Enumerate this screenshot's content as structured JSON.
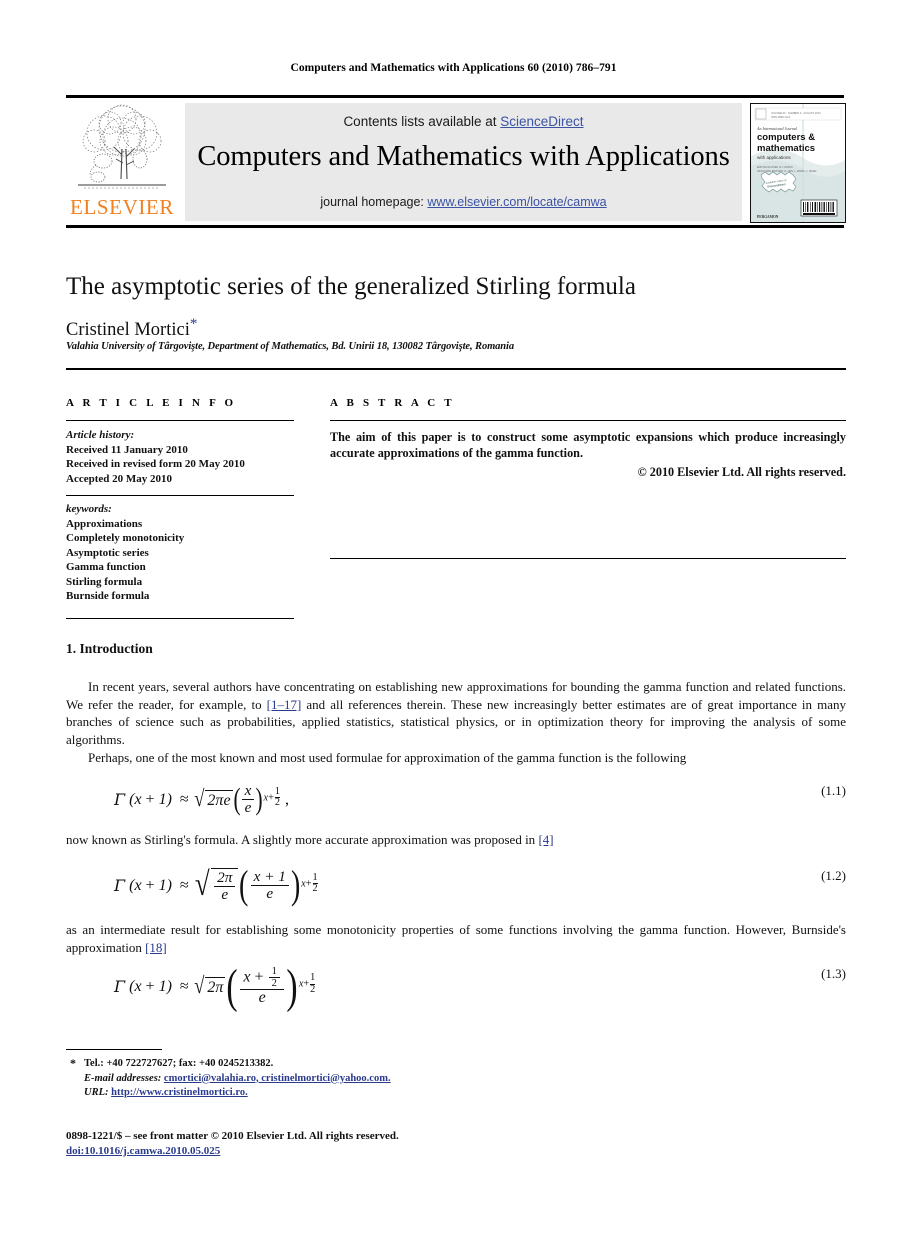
{
  "running_head": "Computers and Mathematics with Applications 60 (2010) 786–791",
  "masthead": {
    "contents_prefix": "Contents lists available at ",
    "sciencedirect": "ScienceDirect",
    "journal_name": "Computers and Mathematics with Applications",
    "homepage_prefix": "journal homepage: ",
    "homepage_url": "www.elsevier.com/locate/camwa",
    "publisher_word": "ELSEVIER",
    "publisher_color": "#F08020",
    "link_color": "#3a53a4",
    "cover": {
      "issn_label": "ISSN 0898-1221",
      "tagline": "An International Journal",
      "line1": "computers &",
      "line2": "mathematics",
      "line3": "with applications",
      "editors": "EDITOR-IN-CHIEF: E.Y. RODIN",
      "editors2": "ASSOCIATE EDITORS: G. HAN, L. WANG, Y. WANG",
      "seal": "available online at ScienceDirect",
      "footer": "PERGAMON"
    }
  },
  "article": {
    "title": "The asymptotic series of the generalized Stirling formula",
    "author": "Cristinel Mortici",
    "author_mark": "*",
    "affiliation": "Valahia University of Târgovişte, Department of Mathematics, Bd. Unirii 18, 130082 Târgovişte, Romania"
  },
  "info": {
    "heading": "A R T I C L E    I N F O",
    "history_label": "Article history:",
    "history": [
      "Received 11 January 2010",
      "Received in revised form 20 May 2010",
      "Accepted 20 May 2010"
    ],
    "keywords_label": "keywords:",
    "keywords": [
      "Approximations",
      "Completely monotonicity",
      "Asymptotic series",
      "Gamma function",
      "Stirling formula",
      "Burnside formula"
    ]
  },
  "abstract": {
    "heading": "A B S T R A C T",
    "text": "The aim of this paper is to construct some asymptotic expansions which produce increasingly accurate approximations of the gamma function.",
    "copyright": "© 2010 Elsevier Ltd. All rights reserved."
  },
  "body": {
    "section_heading": "1. Introduction",
    "p1_a": "In recent years, several authors have concentrating on establishing new approximations for bounding the gamma function and related functions. We refer the reader, for example, to ",
    "p1_ref": "[1–17]",
    "p1_b": " and all references therein. These new increasingly better estimates are of great importance in many branches of science such as probabilities, applied statistics, statistical physics, or in optimization theory for improving the analysis of some algorithms.",
    "p2": "Perhaps, one of the most known and most used formulae for approximation of the gamma function is the following",
    "p3_a": "now known as Stirling's formula. A slightly more accurate approximation was proposed in ",
    "p3_ref": "[4]",
    "p4_a": "as an intermediate result for establishing some monotonicity properties of some functions involving the gamma function. However, Burnside's approximation ",
    "p4_ref": "[18]"
  },
  "equations": {
    "eq1_num": "(1.1)",
    "eq1_latex": "\\Gamma(x+1) \\approx \\sqrt{2\\pi e}\\left(\\frac{x}{e}\\right)^{x+\\frac{1}{2}},",
    "eq2_num": "(1.2)",
    "eq2_latex": "\\Gamma(x+1) \\approx \\sqrt{\\frac{2\\pi}{e}}\\left(\\frac{x+1}{e}\\right)^{x+\\frac{1}{2}}",
    "eq3_num": "(1.3)",
    "eq3_latex": "\\Gamma(x+1) \\approx \\sqrt{2\\pi}\\left(\\frac{x+\\frac{1}{2}}{e}\\right)^{x+\\frac{1}{2}}",
    "gamma": "Γ",
    "approx": "≈",
    "pi": "π",
    "radical": "√",
    "var_x": "x",
    "var_e": "e",
    "one": "1",
    "two": "2",
    "two_pi_e": "2πe",
    "two_pi": "2π",
    "x_plus_one": "x + 1",
    "exponent": "x+",
    "comma": ","
  },
  "footnote": {
    "star": "*",
    "tel": "Tel.: +40 722727627; fax: +40 0245213382.",
    "email_label": "E-mail addresses:",
    "emails": "cmortici@valahia.ro, cristinelmortici@yahoo.com.",
    "url_label": "URL:",
    "url": "http://www.cristinelmortici.ro."
  },
  "front_matter": {
    "line1": "0898-1221/$ – see front matter © 2010 Elsevier Ltd. All rights reserved.",
    "doi": "doi:10.1016/j.camwa.2010.05.025"
  }
}
